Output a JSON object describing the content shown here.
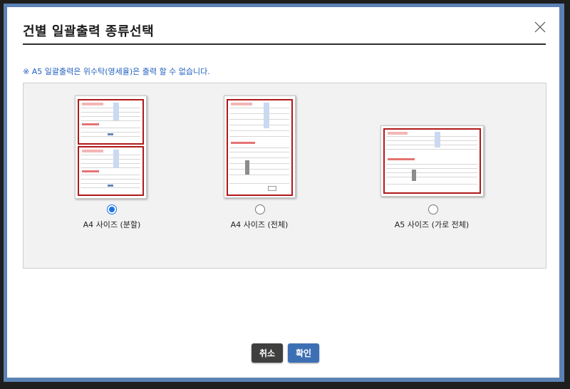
{
  "dialog": {
    "title": "건별 일괄출력 종류선택",
    "notice": "※ A5 일괄출력은 위수탁(영세율)은 출력 할 수 없습니다."
  },
  "options": [
    {
      "label": "A4 사이즈 (분할)",
      "selected": true
    },
    {
      "label": "A4 사이즈 (전체)",
      "selected": false
    },
    {
      "label": "A5 사이즈 (가로 전체)",
      "selected": false
    }
  ],
  "buttons": {
    "cancel": "취소",
    "confirm": "확인"
  },
  "colors": {
    "accent": "#1a73e8",
    "form_border": "#b01818",
    "notice": "#1f5fbf",
    "confirm_button": "#3d6fb4",
    "cancel_button": "#3f3f3f"
  },
  "icons": {
    "close": "close-x-icon",
    "radio": "radio-button"
  }
}
